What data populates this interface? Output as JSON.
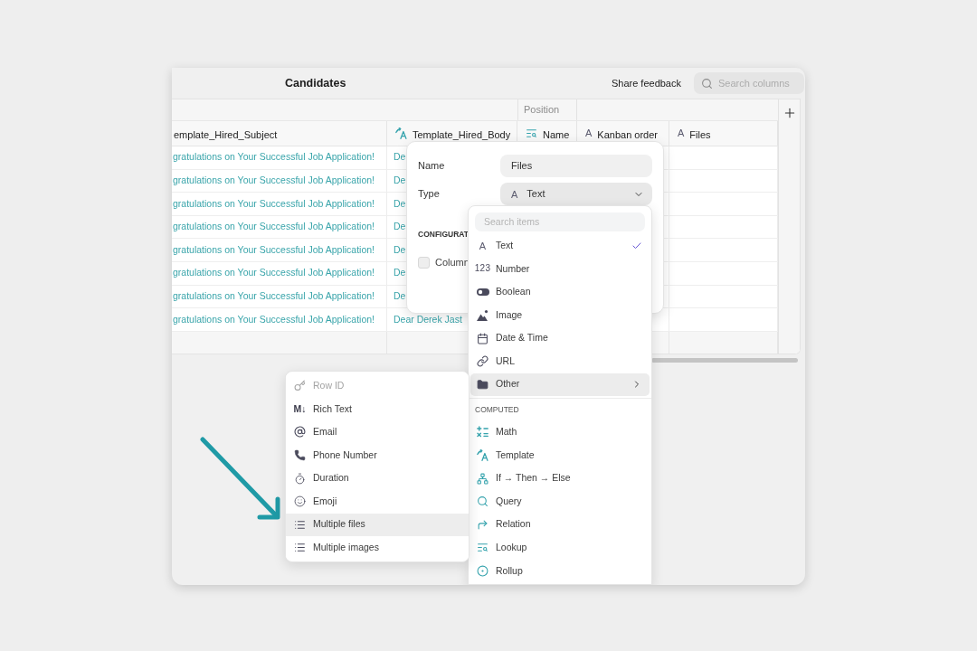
{
  "window": {
    "title": "Candidates",
    "feedback_button": "Share feedback",
    "search": {
      "placeholder": "Search columns"
    }
  },
  "table": {
    "columns": [
      {
        "label": "emplate_Hired_Subject"
      },
      {
        "label": "Template_Hired_Body",
        "kind": "template"
      },
      {
        "label": "Name",
        "kind": "lookup",
        "group": "Position"
      },
      {
        "label": "Kanban order",
        "kind": "text",
        "glyph": "A"
      },
      {
        "label": "Files",
        "kind": "text",
        "glyph": "A"
      }
    ],
    "rows": [
      {
        "cells": [
          "gratulations on Your Successful Job Application!",
          "De"
        ]
      },
      {
        "cells": [
          "gratulations on Your Successful Job Application!",
          "De"
        ]
      },
      {
        "cells": [
          "gratulations on Your Successful Job Application!",
          "De"
        ]
      },
      {
        "cells": [
          "gratulations on Your Successful Job Application!",
          "De"
        ]
      },
      {
        "cells": [
          "gratulations on Your Successful Job Application!",
          "De"
        ]
      },
      {
        "cells": [
          "gratulations on Your Successful Job Application!",
          "De"
        ]
      },
      {
        "cells": [
          "gratulations on Your Successful Job Application!",
          "De"
        ]
      },
      {
        "cells": [
          "gratulations on Your Successful Job Application!",
          "Dear Derek Jast"
        ]
      }
    ]
  },
  "column_editor": {
    "name": {
      "label": "Name",
      "value": "Files"
    },
    "type": {
      "label": "Type",
      "value": "Text",
      "kind": "text",
      "glyph": "A"
    },
    "section": "CONFIGURAT",
    "checkbox": {
      "label": "Column",
      "checked": false
    }
  },
  "type_menu": {
    "search": {
      "placeholder": "Search items"
    },
    "sections": [
      {
        "items": [
          {
            "label": "Text",
            "kind": "text",
            "glyph": "A",
            "checked": true,
            "selected": false
          },
          {
            "label": "Number",
            "kind": "number",
            "glyph": "123",
            "checked": false,
            "selected": false
          },
          {
            "label": "Boolean",
            "kind": "boolean",
            "checked": false,
            "selected": false
          },
          {
            "label": "Image",
            "kind": "image",
            "checked": false,
            "selected": false
          },
          {
            "label": "Date & Time",
            "kind": "datetime",
            "checked": false,
            "selected": false
          },
          {
            "label": "URL",
            "kind": "url",
            "checked": false,
            "selected": false
          },
          {
            "label": "Other",
            "kind": "other",
            "checked": false,
            "selected": true
          }
        ]
      },
      {
        "title": "COMPUTED",
        "items": [
          {
            "label": "Math",
            "kind": "math",
            "checked": false,
            "selected": false
          },
          {
            "label": "Template",
            "kind": "template",
            "checked": false,
            "selected": false
          },
          {
            "label": "If → Then → Else",
            "kind": "conditional",
            "checked": false,
            "selected": false
          },
          {
            "label": "Query",
            "kind": "query",
            "checked": false,
            "selected": false
          },
          {
            "label": "Relation",
            "kind": "relation",
            "checked": false,
            "selected": false
          },
          {
            "label": "Lookup",
            "kind": "lookup",
            "checked": false,
            "selected": false
          },
          {
            "label": "Rollup",
            "kind": "rollup",
            "checked": false,
            "selected": false
          }
        ]
      }
    ]
  },
  "other_menu": {
    "items": [
      {
        "label": "Row ID",
        "kind": "rowid",
        "disabled": true,
        "selected": false
      },
      {
        "label": "Rich Text",
        "kind": "richtext",
        "glyph": "M↓",
        "disabled": false,
        "selected": false
      },
      {
        "label": "Email",
        "kind": "email",
        "disabled": false,
        "selected": false
      },
      {
        "label": "Phone Number",
        "kind": "phone",
        "disabled": false,
        "selected": false
      },
      {
        "label": "Duration",
        "kind": "duration",
        "disabled": false,
        "selected": false
      },
      {
        "label": "Emoji",
        "kind": "emoji",
        "disabled": false,
        "selected": false
      },
      {
        "label": "Multiple files",
        "kind": "files",
        "disabled": false,
        "selected": true
      },
      {
        "label": "Multiple images",
        "kind": "images",
        "disabled": false,
        "selected": false
      }
    ]
  }
}
